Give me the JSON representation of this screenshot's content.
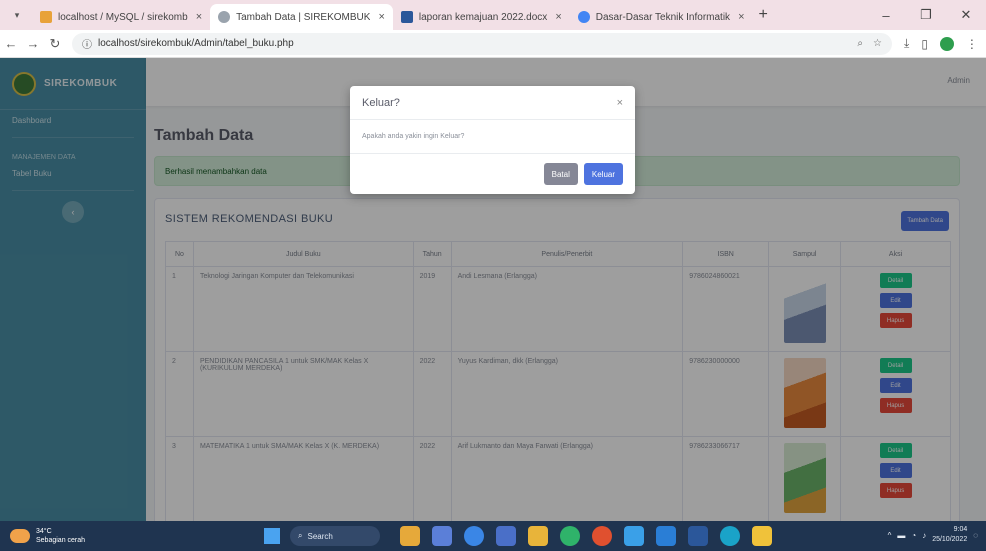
{
  "browser": {
    "tabs": [
      {
        "title": "localhost / MySQL / sirekomb",
        "fav_color": "#e8a23a",
        "active": false
      },
      {
        "title": "Tambah Data | SIREKOMBUK",
        "fav_color": "#9aa3ad",
        "active": true
      },
      {
        "title": "laporan kemajuan 2022.docx",
        "fav_color": "#2b579a",
        "active": false
      },
      {
        "title": "Dasar-Dasar Teknik Informatik",
        "fav_color": "#4285f4",
        "active": false
      }
    ],
    "url": "localhost/sirekombuk/Admin/tabel_buku.php"
  },
  "app": {
    "brand": "SIREKOMBUK",
    "sidebar": {
      "dashboard": "Dashboard",
      "heading": "Manajemen Data",
      "item": "Tabel Buku",
      "toggle": "‹"
    },
    "user": "Admin",
    "page_title": "Tambah Data",
    "alert": "Berhasil menambahkan data",
    "card_title": "SISTEM REKOMENDASI BUKU",
    "add_button": "Tambah Data",
    "table": {
      "headers": [
        "No",
        "Judul Buku",
        "Tahun",
        "Penulis/Penerbit",
        "ISBN",
        "Sampul",
        "Aksi"
      ],
      "rows": [
        {
          "no": "1",
          "judul": "Teknologi Jaringan Komputer dan Telekomunikasi",
          "tahun": "2019",
          "penulis": "Andi Lesmana (Erlangga)",
          "isbn": "9786024860021"
        },
        {
          "no": "2",
          "judul": "PENDIDIKAN PANCASILA 1 untuk SMK/MAK Kelas X (KURIKULUM MERDEKA)",
          "tahun": "2022",
          "penulis": "Yuyus Kardiman, dkk (Erlangga)",
          "isbn": "9786230000000"
        },
        {
          "no": "3",
          "judul": "MATEMATIKA 1 untuk SMA/MAK Kelas X (K. MERDEKA)",
          "tahun": "2022",
          "penulis": "Arif Lukmanto dan Maya Farwati (Erlangga)",
          "isbn": "9786233066717"
        }
      ],
      "actions": {
        "detail": "Detail",
        "edit": "Edit",
        "hapus": "Hapus"
      }
    }
  },
  "modal": {
    "title": "Keluar?",
    "close": "×",
    "body": "Apakah anda yakin ingin Keluar?",
    "cancel": "Batal",
    "confirm": "Keluar"
  },
  "taskbar": {
    "weather_temp": "34°C",
    "weather_desc": "Sebagian cerah",
    "search": "Search",
    "time": "9:04",
    "date": "25/10/2022"
  }
}
